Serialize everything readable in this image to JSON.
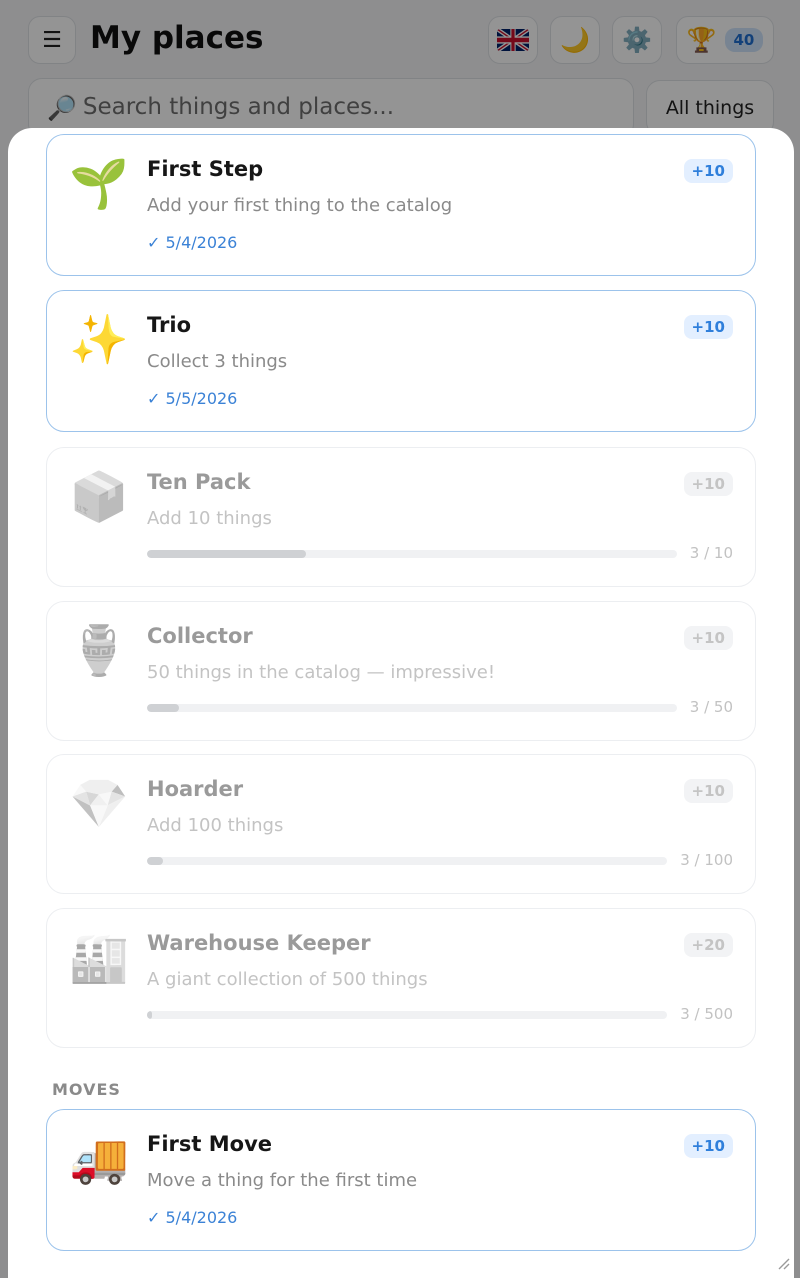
{
  "header": {
    "title": "My places",
    "menu_icon": "☰",
    "theme_icon": "🌙",
    "settings_icon": "⚙️",
    "trophy_icon": "🏆",
    "points": "40"
  },
  "search": {
    "icon": "🔎",
    "placeholder": "Search things and places..."
  },
  "filter": {
    "label": "All things"
  },
  "achievements": [
    {
      "emoji": "🌱",
      "title": "First Step",
      "desc": "Add your first thing to the catalog",
      "points": "+10",
      "state": "done",
      "date": "✓ 5/4/2026"
    },
    {
      "emoji": "✨",
      "title": "Trio",
      "desc": "Collect 3 things",
      "points": "+10",
      "state": "done",
      "date": "✓ 5/5/2026"
    },
    {
      "emoji": "📦",
      "title": "Ten Pack",
      "desc": "Add 10 things",
      "points": "+10",
      "state": "locked",
      "progress": 0.3,
      "count": "3 / 10"
    },
    {
      "emoji": "🏺",
      "title": "Collector",
      "desc": "50 things in the catalog — impressive!",
      "points": "+10",
      "state": "locked",
      "progress": 0.06,
      "count": "3 / 50"
    },
    {
      "emoji": "💎",
      "title": "Hoarder",
      "desc": "Add 100 things",
      "points": "+10",
      "state": "locked",
      "progress": 0.03,
      "count": "3 / 100"
    },
    {
      "emoji": "🏭",
      "title": "Warehouse Keeper",
      "desc": "A giant collection of 500 things",
      "points": "+20",
      "state": "locked",
      "progress": 0.006,
      "count": "3 / 500"
    }
  ],
  "moves_section": {
    "label": "MOVES",
    "achievements": [
      {
        "emoji": "🚚",
        "title": "First Move",
        "desc": "Move a thing for the first time",
        "points": "+10",
        "state": "done",
        "date": "✓ 5/4/2026"
      }
    ]
  },
  "colors": {
    "accent": "#3b82d6",
    "done_border": "#9cc3eb",
    "badge_bg": "#e3efff"
  }
}
